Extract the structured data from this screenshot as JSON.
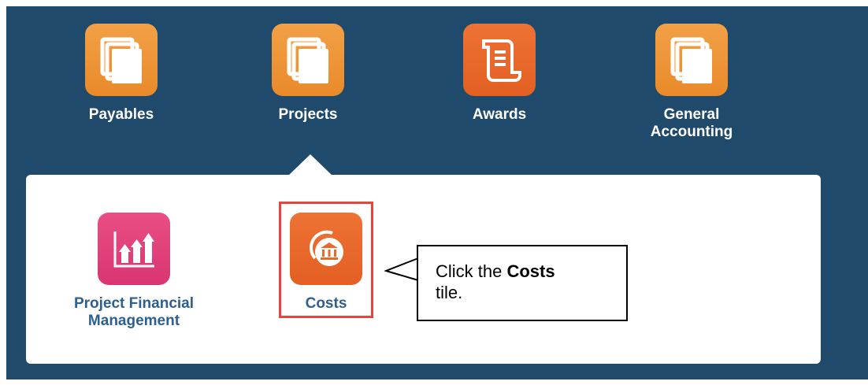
{
  "springboard": {
    "tiles": [
      {
        "label": "Payables",
        "icon": "stacked-pages-icon"
      },
      {
        "label": "Projects",
        "icon": "stacked-pages-icon"
      },
      {
        "label": "Awards",
        "icon": "scroll-document-icon"
      },
      {
        "label": "General Accounting",
        "icon": "stacked-pages-icon"
      }
    ]
  },
  "projects_panel": {
    "tiles": [
      {
        "label": "Project Financial Management",
        "icon": "bar-chart-up-icon"
      },
      {
        "label": "Costs",
        "icon": "bank-building-icon"
      }
    ]
  },
  "callout": {
    "prefix": "Click the ",
    "emphasis": "Costs",
    "suffix": "tile."
  },
  "colors": {
    "background": "#1f4a6b",
    "orange_tile": "#ee9337",
    "rust_tile": "#e8692b",
    "pink_tile": "#e0437a",
    "subtile_label": "#2d5f8f",
    "highlight_border": "#e2463f"
  }
}
